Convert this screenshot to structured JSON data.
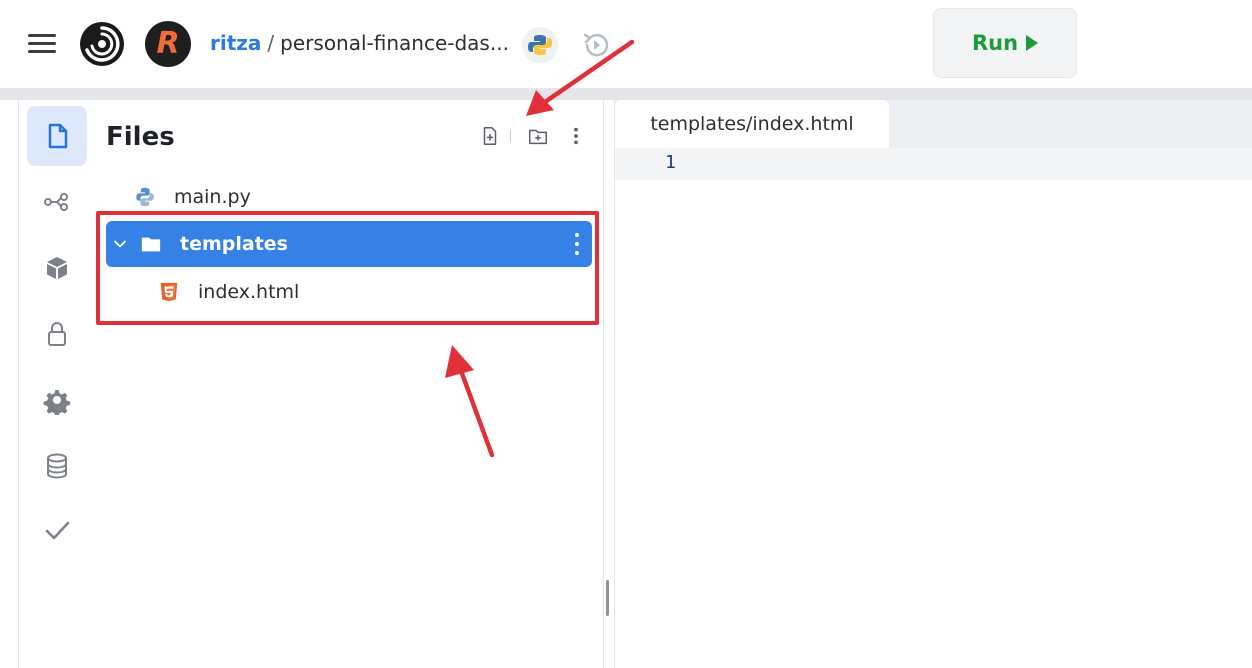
{
  "topbar": {
    "owner": "ritza",
    "separator": "/",
    "repl_name": "personal-finance-das...",
    "avatar_letter": "R",
    "run_label": "Run"
  },
  "rail": {
    "items": [
      "files-icon",
      "version-control-icon",
      "packages-icon",
      "secrets-icon",
      "settings-icon",
      "database-icon",
      "unit-tests-icon"
    ],
    "active": "files-icon"
  },
  "files": {
    "title": "Files",
    "tree": [
      {
        "name": "main.py",
        "type": "python-file",
        "depth": 0
      },
      {
        "name": "templates",
        "type": "folder",
        "expanded": true,
        "selected": true,
        "depth": 0
      },
      {
        "name": "index.html",
        "type": "html-file",
        "depth": 1
      }
    ]
  },
  "editor": {
    "tab_label": "templates/index.html",
    "line_numbers": [
      "1"
    ]
  },
  "colors": {
    "accent": "#3681e6",
    "run_green": "#1c9a3c",
    "annotation_red": "#e0313b",
    "owner_blue": "#2a7be0"
  }
}
